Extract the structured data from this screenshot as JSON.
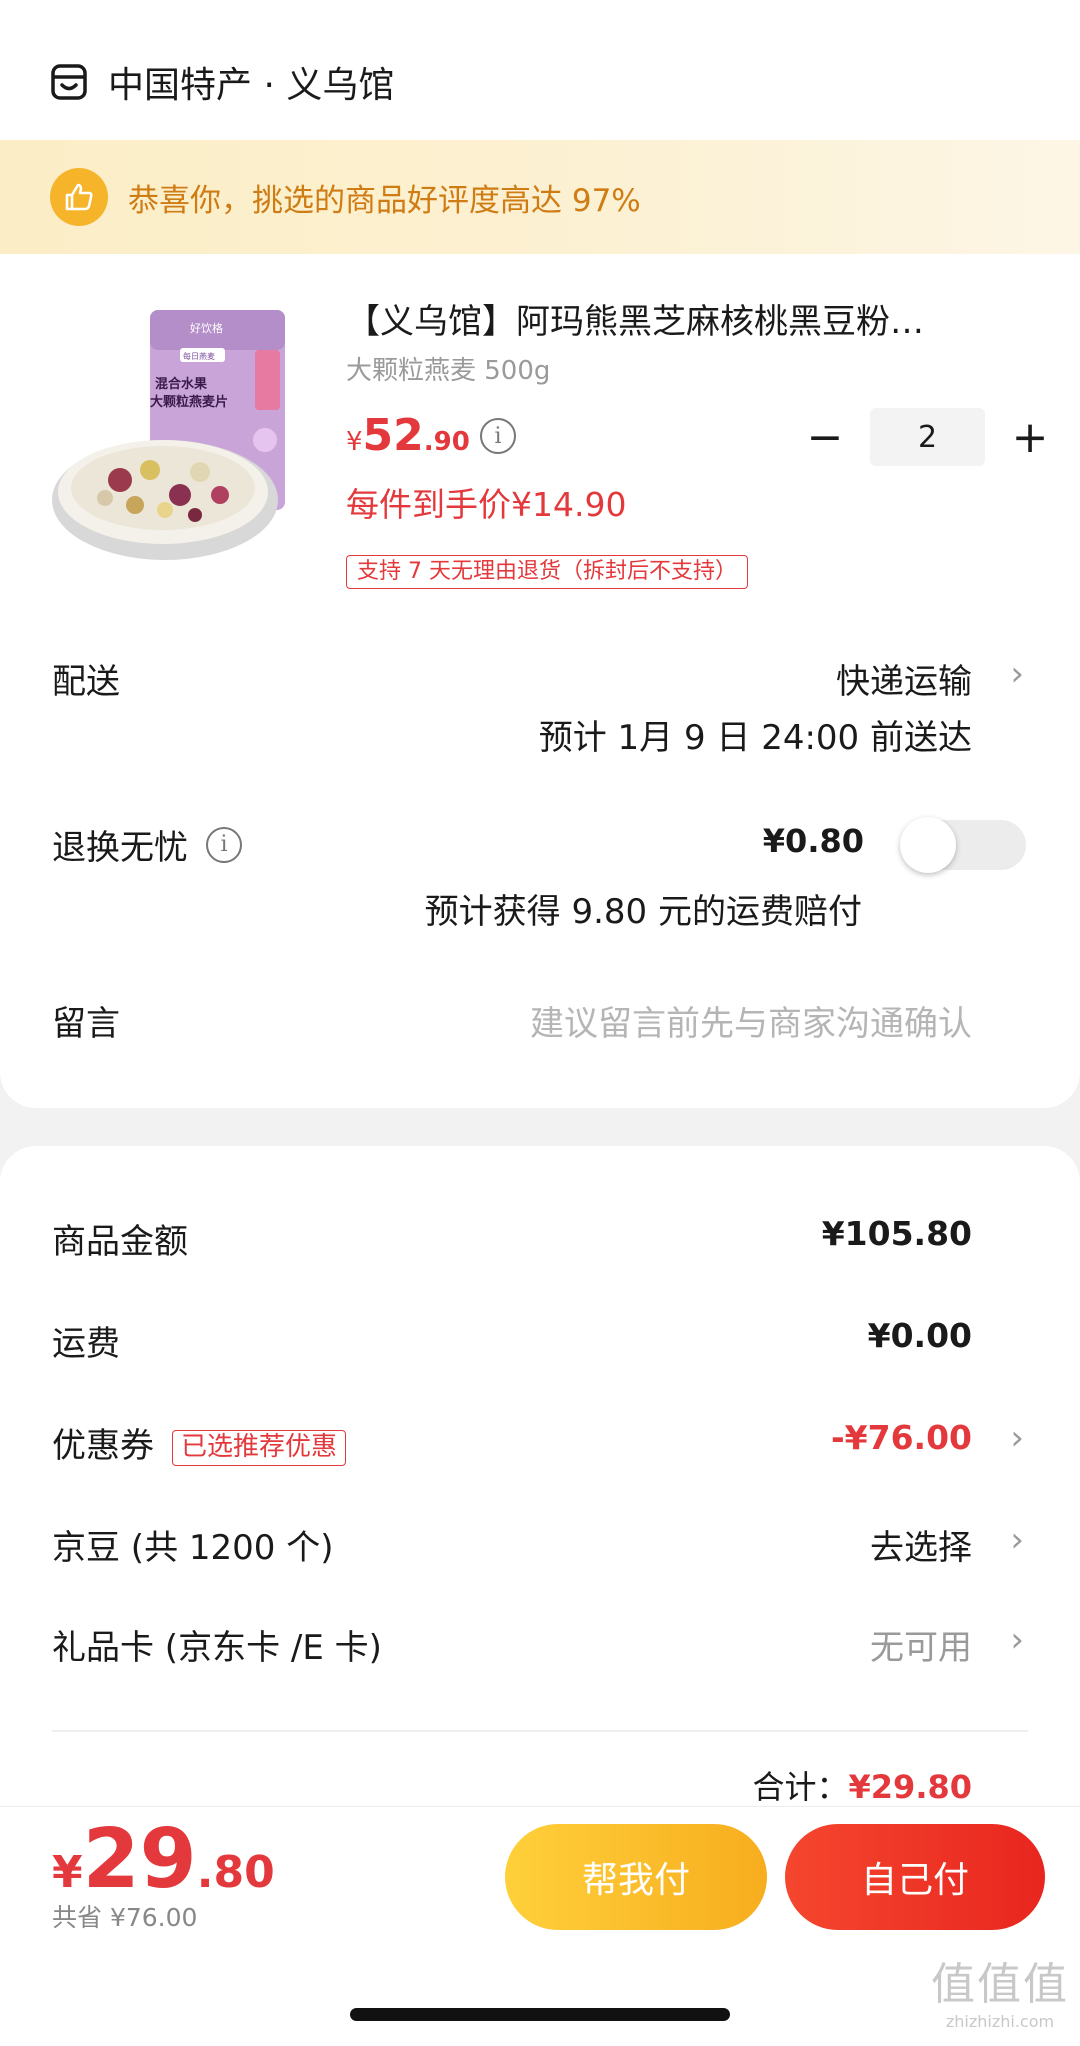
{
  "shop": {
    "name": "中国特产 · 义乌馆",
    "icon": "store-icon"
  },
  "banner": {
    "text": "恭喜你，挑选的商品好评度高达 97%",
    "icon": "thumbs-up-icon"
  },
  "product": {
    "title": "【义乌馆】阿玛熊黑芝麻核桃黑豆粉…",
    "spec": "大颗粒燕麦 500g",
    "price_symbol": "¥",
    "price_int": "52",
    "price_dec": ".90",
    "unit_price": "每件到手价¥14.90",
    "return_tag": "支持 7 天无理由退货（拆封后不支持）",
    "quantity": "2",
    "minus": "−",
    "plus": "+",
    "image_text_top": "好饮格",
    "image_text_mid": "每日燕麦",
    "image_text_a": "混合水果",
    "image_text_b": "大颗粒燕麦片"
  },
  "delivery": {
    "label": "配送",
    "method": "快递运输",
    "eta": "预计 1月 9 日 24:00 前送达"
  },
  "return_insurance": {
    "label": "退换无忧",
    "price": "¥0.80",
    "note": "预计获得 9.80 元的运费赔付",
    "enabled": false
  },
  "message": {
    "label": "留言",
    "placeholder": "建议留言前先与商家沟通确认"
  },
  "summary": {
    "goods_label": "商品金额",
    "goods_value": "¥105.80",
    "shipping_label": "运费",
    "shipping_value": "¥0.00",
    "coupon_label": "优惠券",
    "coupon_badge": "已选推荐优惠",
    "coupon_value": "-¥76.00",
    "jingdou_label": "京豆 (共 1200 个)",
    "jingdou_value": "去选择",
    "giftcard_label": "礼品卡 (京东卡 /E 卡)",
    "giftcard_value": "无可用",
    "total_label": "合计：",
    "total_value": "¥29.80"
  },
  "footer": {
    "price_symbol": "¥",
    "price_int": "29",
    "price_dec": ".80",
    "saved": "共省 ¥76.00",
    "help_pay": "帮我付",
    "self_pay": "自己付"
  },
  "watermark": {
    "big": "值值值",
    "small": "zhizhizhi.com"
  },
  "colors": {
    "accent": "#e4393c",
    "banner_text": "#cf7c14",
    "help_btn": "#f7ad1e",
    "self_btn": "#e8261f"
  }
}
